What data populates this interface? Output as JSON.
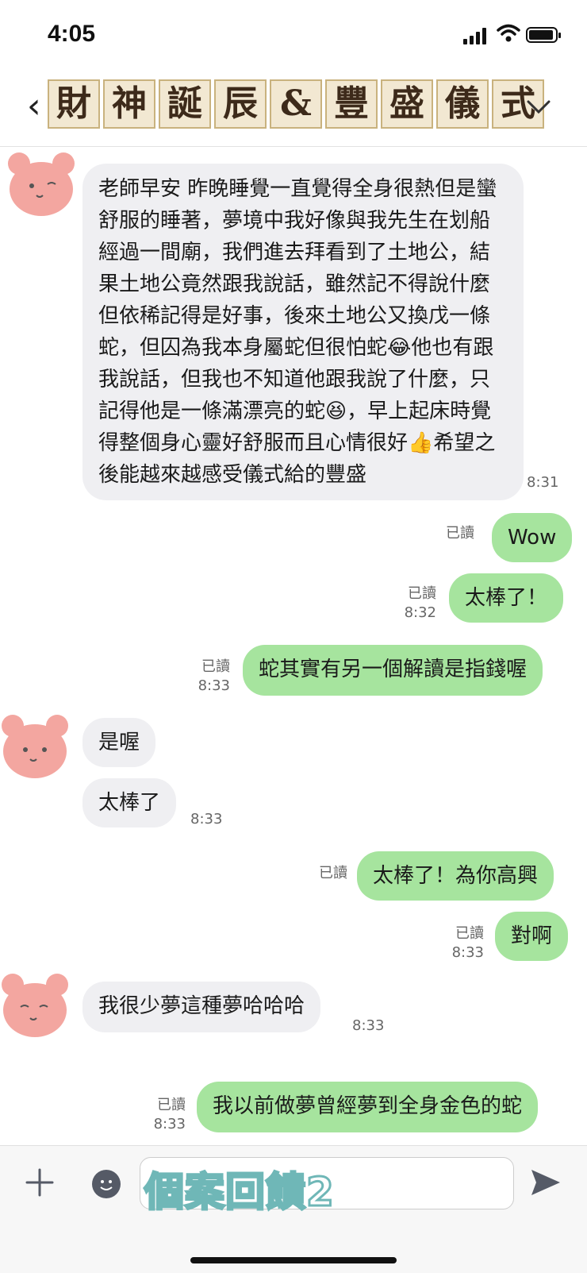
{
  "status_bar": {
    "time": "4:05"
  },
  "header": {
    "title_chars": [
      "財",
      "神",
      "誕",
      "辰",
      "&",
      "豐",
      "盛",
      "儀",
      "式"
    ]
  },
  "messages": [
    {
      "side": "in",
      "text": "老師早安 昨晚睡覺一直覺得全身很熱但是蠻舒服的睡著，夢境中我好像與我先生在划船經過一間廟，我們進去拜看到了土地公，結果土地公竟然跟我說話，雖然記不得說什麼但依稀記得是好事，後來土地公又換戊一條蛇，但囚為我本身屬蛇但很怕蛇😂他也有跟我說話，但我也不知道他跟我說了什麼，只記得他是一條滿漂亮的蛇😆，早上起床時覺得整個身心靈好舒服而且心情很好👍希望之後能越來越感受儀式給的豐盛",
      "time": "8:31"
    },
    {
      "side": "out",
      "text": "Wow",
      "read": "已讀",
      "time": ""
    },
    {
      "side": "out",
      "text": "太棒了！",
      "read": "已讀",
      "time": "8:32"
    },
    {
      "side": "out",
      "text": "蛇其實有另一個解讀是指錢喔",
      "read": "已讀",
      "time": "8:33"
    },
    {
      "side": "in",
      "text": "是喔",
      "time": ""
    },
    {
      "side": "in",
      "text": "太棒了",
      "time": "8:33"
    },
    {
      "side": "out",
      "text": "太棒了！為你高興",
      "read": "已讀",
      "time": ""
    },
    {
      "side": "out",
      "text": "對啊",
      "read": "已讀",
      "time": "8:33"
    },
    {
      "side": "in",
      "text": "我很少夢這種夢哈哈哈",
      "time": "8:33"
    },
    {
      "side": "out",
      "text": "我以前做夢曾經夢到全身金色的蛇",
      "read": "已讀",
      "time": "8:33"
    }
  ],
  "input_bar": {
    "overlay_text": "個案回饋2"
  },
  "colors": {
    "out_bubble": "#a6e49e",
    "in_bubble": "#efeff2",
    "avatar": "#f3a6a0"
  },
  "icons": [
    "back-arrow-icon",
    "chevron-down-icon",
    "plus-icon",
    "emoji-icon",
    "send-icon",
    "bear-avatar-icon"
  ]
}
